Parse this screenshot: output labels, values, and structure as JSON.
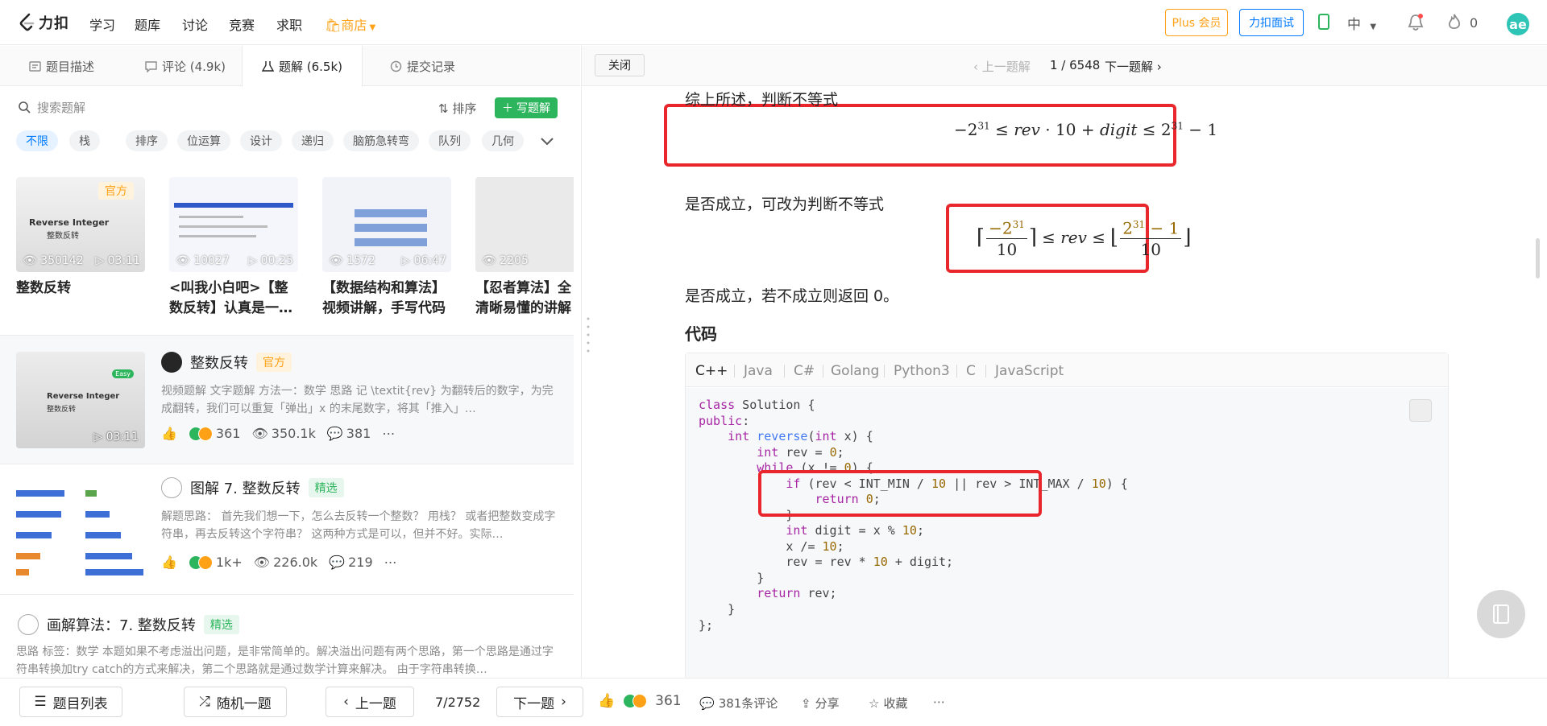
{
  "nav": {
    "logo_text": "力扣",
    "links": [
      "学习",
      "题库",
      "讨论",
      "竞赛",
      "求职"
    ],
    "store": "商店",
    "plus": "Plus 会员",
    "interview": "力扣面试",
    "lang": "中",
    "points": "0",
    "avatar_letter": "ae"
  },
  "left_tabs": {
    "desc": "题目描述",
    "comments": "评论 (4.9k)",
    "solutions": "题解 (6.5k)",
    "submissions": "提交记录"
  },
  "search": {
    "placeholder": "搜索题解",
    "sort": "排序",
    "write": "写题解"
  },
  "tags": [
    "不限",
    "栈",
    "排序",
    "位运算",
    "设计",
    "递归",
    "脑筋急转弯",
    "队列",
    "几何"
  ],
  "videos": [
    {
      "views": "350142",
      "duration": "03:11",
      "title": "整数反转",
      "badge": "官方",
      "thumb_title": "Reverse Integer",
      "thumb_sub": "整数反转"
    },
    {
      "views": "10027",
      "duration": "00:25",
      "title": "<叫我小白吧>【整数反转】认真是一…"
    },
    {
      "views": "1572",
      "duration": "06:47",
      "title": "【数据结构和算法】视频讲解，手写代码"
    },
    {
      "views": "2205",
      "duration": "",
      "title": "【忍者算法】全清晰易懂的讲解"
    }
  ],
  "solutions": [
    {
      "title": "整数反转",
      "badge": "官方",
      "summary": "视频题解 文字题解 方法一：数学 思路 记 \\textit{rev} 为翻转后的数字，为完成翻转，我们可以重复「弹出」x 的末尾数字，将其「推入」…",
      "duration": "03:11",
      "likes": "361",
      "views": "350.1k",
      "comments": "381",
      "thumb_title": "Reverse Integer",
      "thumb_sub": "整数反转",
      "thumb_badge": "Easy"
    },
    {
      "title": "图解 7. 整数反转",
      "badge": "精选",
      "summary": "解题思路： 首先我们想一下，怎么去反转一个整数？ 用栈？ 或者把整数变成字符串，再去反转这个字符串？ 这两种方式是可以，但并不好。实际…",
      "likes": "1k+",
      "views": "226.0k",
      "comments": "219"
    },
    {
      "title": "画解算法：7. 整数反转",
      "badge": "精选",
      "summary": "思路 标签：数学 本题如果不考虑溢出问题，是非常简单的。解决溢出问题有两个思路，第一个思路是通过字符串转换加try catch的方式来解决，第二个思路就是通过数学计算来解决。 由于字符串转换…"
    }
  ],
  "bottom": {
    "list": "题目列表",
    "random": "随机一题",
    "prev": "上一题",
    "pager": "7/2752",
    "next": "下一题",
    "likes": "361",
    "comments": "381条评论",
    "share": "分享",
    "fav": "收藏"
  },
  "right_head": {
    "close": "关闭",
    "prev": "上一题解",
    "pager": "1 / 6548",
    "next": "下一题解"
  },
  "article": {
    "p1": "综上所述，判断不等式",
    "p2": "是否成立，可改为判断不等式",
    "p3": "是否成立，若不成立则返回 0。",
    "code_title": "代码",
    "code_tabs": [
      "C++",
      "Java",
      "C#",
      "Golang",
      "Python3",
      "C",
      "JavaScript"
    ]
  },
  "colors": {
    "accent": "#ffa116",
    "blue": "#007aff",
    "green": "#2db55d",
    "highlight_box": "#e8262b"
  }
}
